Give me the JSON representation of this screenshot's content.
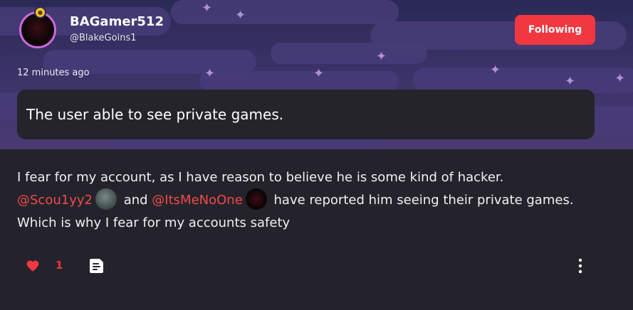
{
  "post": {
    "author": {
      "display_name": "BAGamer512",
      "handle": "@BlakeGoins1",
      "avatar_icon": "user-avatar",
      "badge_icon": "lock-badge-icon"
    },
    "follow_button": {
      "label": "Following",
      "color": "#f13840"
    },
    "timestamp": "12 minutes ago",
    "title": "The user able to see private games.",
    "body": {
      "part1": "I fear for my account, as I have reason to believe he is some kind of hacker.",
      "mention1": "@Scou1yy2",
      "between": "and",
      "mention2": "@ItsMeNoOne",
      "part2": "have reported him seeing their private games. Which is why I fear for my accounts safety"
    },
    "actions": {
      "like_icon": "heart-icon",
      "like_count": "1",
      "share_icon": "share-icon",
      "more_icon": "more-vertical-icon"
    }
  },
  "colors": {
    "accent": "#f13840",
    "background": "#24232b",
    "mention": "#f14a4a"
  }
}
